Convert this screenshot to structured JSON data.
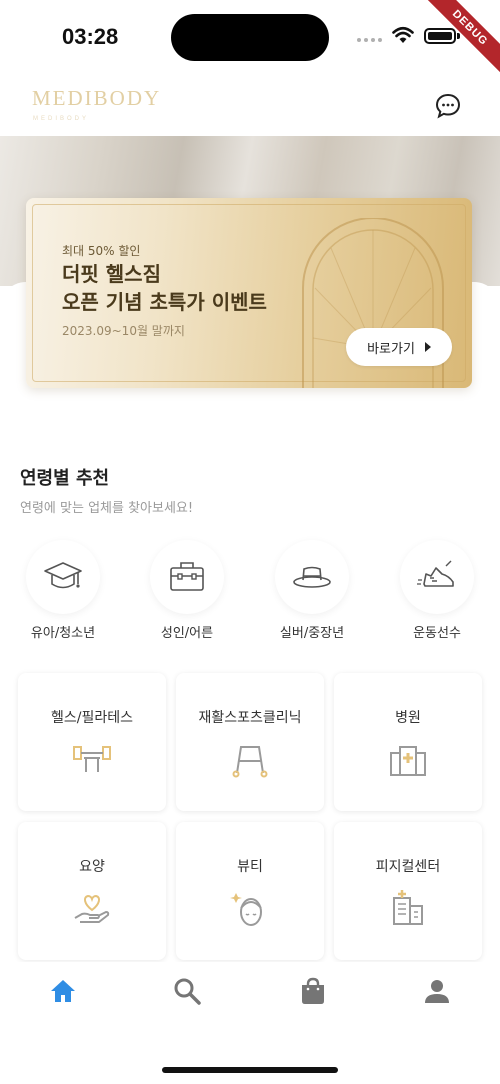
{
  "status_bar": {
    "time": "03:28",
    "debug_label": "DEBUG"
  },
  "header": {
    "logo": "MEDIBODY",
    "logo_sub": "MEDIBODY"
  },
  "promo": {
    "eyebrow": "최대 50% 할인",
    "title_line1": "더핏 헬스짐",
    "title_line2": "오픈 기념 초특가 이벤트",
    "date": "2023.09~10월 말까지",
    "button_label": "바로가기"
  },
  "age_section": {
    "title": "연령별 추천",
    "subtitle": "연령에 맞는 업체를 찾아보세요!",
    "items": [
      {
        "label": "유아/청소년",
        "icon": "graduation-cap-icon"
      },
      {
        "label": "성인/어른",
        "icon": "briefcase-icon"
      },
      {
        "label": "실버/중장년",
        "icon": "hat-icon"
      },
      {
        "label": "운동선수",
        "icon": "running-shoe-icon"
      }
    ]
  },
  "services": [
    {
      "label": "헬스/필라테스",
      "icon": "dumbbell-bench-icon"
    },
    {
      "label": "재활스포츠클리닉",
      "icon": "walker-icon"
    },
    {
      "label": "병원",
      "icon": "hospital-icon"
    },
    {
      "label": "요양",
      "icon": "heart-hand-icon"
    },
    {
      "label": "뷰티",
      "icon": "face-towel-icon"
    },
    {
      "label": "피지컬센터",
      "icon": "building-icon"
    }
  ],
  "bottom_nav": [
    {
      "name": "home",
      "icon": "home-icon",
      "active": true
    },
    {
      "name": "search",
      "icon": "search-icon",
      "active": false
    },
    {
      "name": "shop",
      "icon": "shopping-bag-icon",
      "active": false
    },
    {
      "name": "profile",
      "icon": "person-icon",
      "active": false
    }
  ],
  "colors": {
    "accent": "#2f8de4",
    "gold": "#d9b876",
    "icon_gold": "#e5c27a",
    "icon_gray": "#9a9a9a"
  }
}
